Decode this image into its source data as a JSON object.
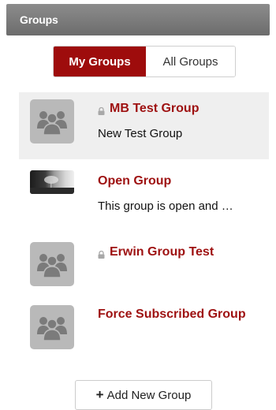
{
  "panel": {
    "title": "Groups"
  },
  "tabs": {
    "my_groups": "My Groups",
    "all_groups": "All Groups"
  },
  "groups": [
    {
      "name": "MB Test Group",
      "description": "New Test Group",
      "locked": true,
      "avatar": "people-icon",
      "selected": true
    },
    {
      "name": "Open Group",
      "description": "This group is open and …",
      "locked": false,
      "avatar": "photo",
      "selected": false
    },
    {
      "name": "Erwin Group Test",
      "description": "",
      "locked": true,
      "avatar": "people-icon",
      "selected": false
    },
    {
      "name": "Force Subscribed Group",
      "description": "",
      "locked": false,
      "avatar": "people-icon",
      "selected": false
    }
  ],
  "actions": {
    "add_new_group_plus": "+",
    "add_new_group": "Add New Group"
  },
  "colors": {
    "accent": "#9e0c0c",
    "header_bg": "#7a7a7a",
    "selected_row_bg": "#efefef",
    "avatar_bg": "#b9b9b9"
  }
}
